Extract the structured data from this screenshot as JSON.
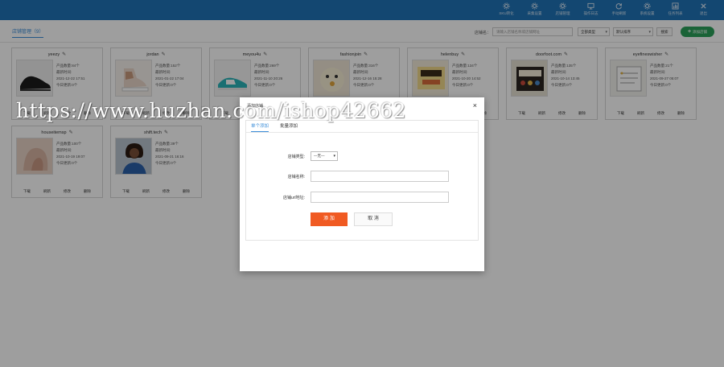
{
  "topnav": [
    {
      "label": "SKU转化",
      "icon": "gear-icon"
    },
    {
      "label": "采集设置",
      "icon": "gear-icon"
    },
    {
      "label": "店铺管理",
      "icon": "gear-icon"
    },
    {
      "label": "操作日志",
      "icon": "monitor-icon"
    },
    {
      "label": "手动刷新",
      "icon": "refresh-icon"
    },
    {
      "label": "系统设置",
      "icon": "gear-icon"
    },
    {
      "label": "任务列表",
      "icon": "chart-icon"
    },
    {
      "label": "退出",
      "icon": "close-icon"
    }
  ],
  "toolbar": {
    "tab_label": "店铺管理（9）",
    "search_label": "店铺名：",
    "search_placeholder": "请输入店铺名称或店铺网址",
    "select_a": "全部类型",
    "select_b": "默认排序",
    "search_button": "搜索",
    "add_button": "添加店铺"
  },
  "card_labels": {
    "products": "产品数量:",
    "updated": "最新时间:",
    "today": "今日更新:0个",
    "actions": [
      "下载",
      "刷新",
      "修改",
      "删除"
    ]
  },
  "stores": [
    {
      "name": "yeezy",
      "count": "84个",
      "date": "2021-12-22 17:51"
    },
    {
      "name": "jordan",
      "count": "152个",
      "date": "2021-01-22 17:04"
    },
    {
      "name": "meyou4u",
      "count": "269个",
      "date": "2021-11-10 20:26"
    },
    {
      "name": "fashionjoin",
      "count": "316个",
      "date": "2021-12-16 15:28"
    },
    {
      "name": "helenbuy",
      "count": "134个",
      "date": "2021-10-20 14:52"
    },
    {
      "name": "doorfoot.com",
      "count": "135个",
      "date": "2021-10-14 13:45"
    },
    {
      "name": "eyefineswisher",
      "count": "21个",
      "date": "2021-09-27 05:07"
    },
    {
      "name": "houseitemsp",
      "count": "100个",
      "date": "2021-10-19 19:07"
    },
    {
      "name": "shift.tech",
      "count": "39个",
      "date": "2021-09-21 16:16"
    }
  ],
  "modal": {
    "title": "添加店铺",
    "tab_single": "单个添加",
    "tab_batch": "批量添加",
    "type_label": "店铺类型:",
    "type_value": "—无—",
    "name_label": "店铺名称:",
    "url_label": "店铺url地址:",
    "submit": "添 加",
    "cancel": "取 消"
  },
  "watermark": "https://www.huzhan.com/ishop42662"
}
